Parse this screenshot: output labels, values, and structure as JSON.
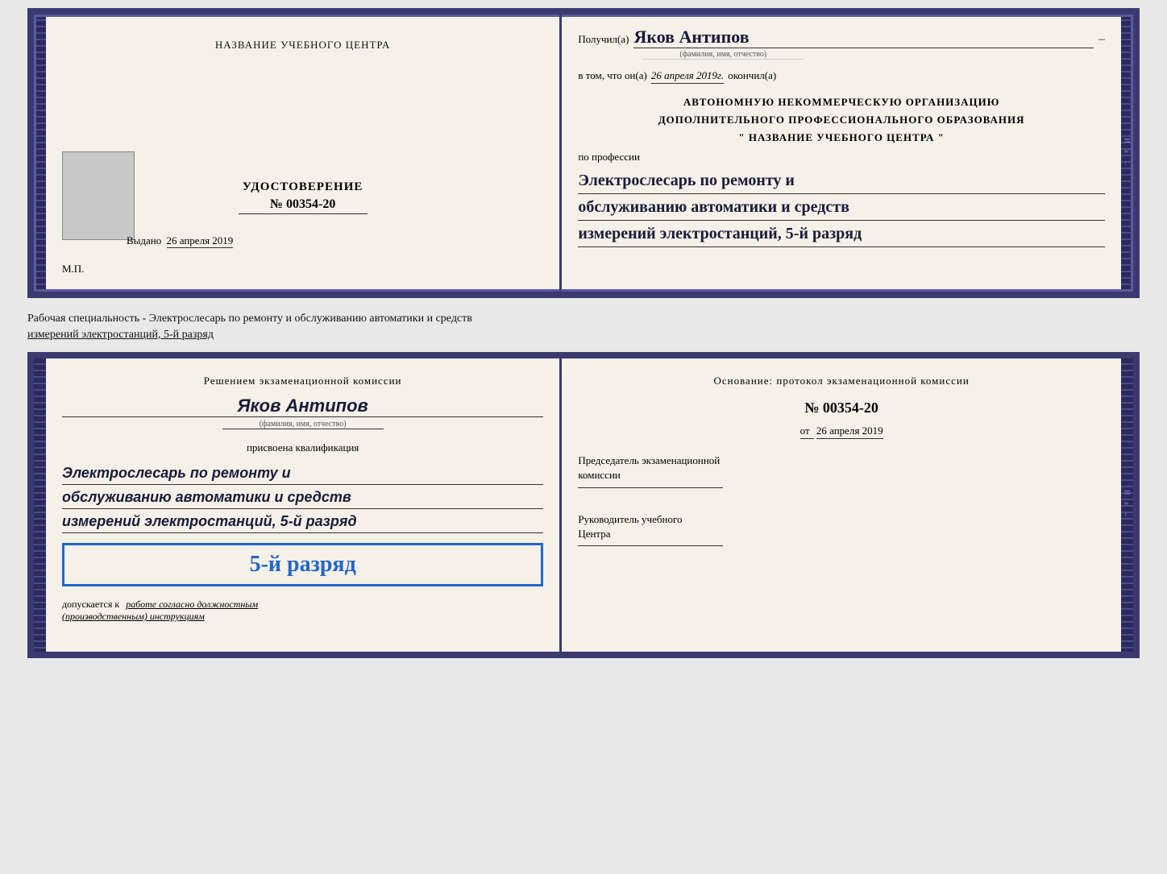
{
  "page": {
    "background": "#e8e8e8"
  },
  "diploma": {
    "left": {
      "title": "НАЗВАНИЕ УЧЕБНОГО ЦЕНТРА",
      "cert_label": "УДОСТОВЕРЕНИЕ",
      "cert_number": "№ 00354-20",
      "issued_label": "Выдано",
      "issued_date": "26 апреля 2019",
      "mp_label": "М.П."
    },
    "right": {
      "received_label": "Получил(а)",
      "name": "Яков Антипов",
      "name_subtitle": "(фамилия, имя, отчество)",
      "cert_text_pre": "в том, что он(а)",
      "cert_date": "26 апреля 2019г.",
      "cert_date_post": "окончил(а)",
      "org_line1": "АВТОНОМНУЮ НЕКОММЕРЧЕСКУЮ ОРГАНИЗАЦИЮ",
      "org_line2": "ДОПОЛНИТЕЛЬНОГО ПРОФЕССИОНАЛЬНОГО ОБРАЗОВАНИЯ",
      "org_quote": "\"",
      "org_name": "НАЗВАНИЕ УЧЕБНОГО ЦЕНТРА",
      "org_quote_end": "\"",
      "profession_label": "по профессии",
      "profession_line1": "Электрослесарь по ремонту и",
      "profession_line2": "обслуживанию автоматики и средств",
      "profession_line3": "измерений электростанций, 5-й разряд"
    }
  },
  "specialty_text": {
    "line1": "Рабочая специальность - Электрослесарь по ремонту и обслуживанию автоматики и средств",
    "line2": "измерений электростанций, 5-й разряд"
  },
  "qualification": {
    "left": {
      "title": "Решением экзаменационной комиссии",
      "name": "Яков Антипов",
      "name_subtitle": "(фамилия, имя, отчество)",
      "assigned_label": "присвоена квалификация",
      "profession_line1": "Электрослесарь по ремонту и",
      "profession_line2": "обслуживанию автоматики и средств",
      "profession_line3": "измерений электростанций, 5-й разряд",
      "rank_badge": "5-й разряд",
      "allowed_pre": "допускается к",
      "allowed_work": "работе согласно должностным",
      "allowed_work2": "(производственным) инструкциям"
    },
    "right": {
      "basis_label": "Основание: протокол экзаменационной комиссии",
      "number": "№  00354-20",
      "date_pre": "от",
      "date": "26 апреля 2019",
      "chairman_line1": "Председатель экзаменационной",
      "chairman_line2": "комиссии",
      "head_line1": "Руководитель учебного",
      "head_line2": "Центра"
    }
  }
}
